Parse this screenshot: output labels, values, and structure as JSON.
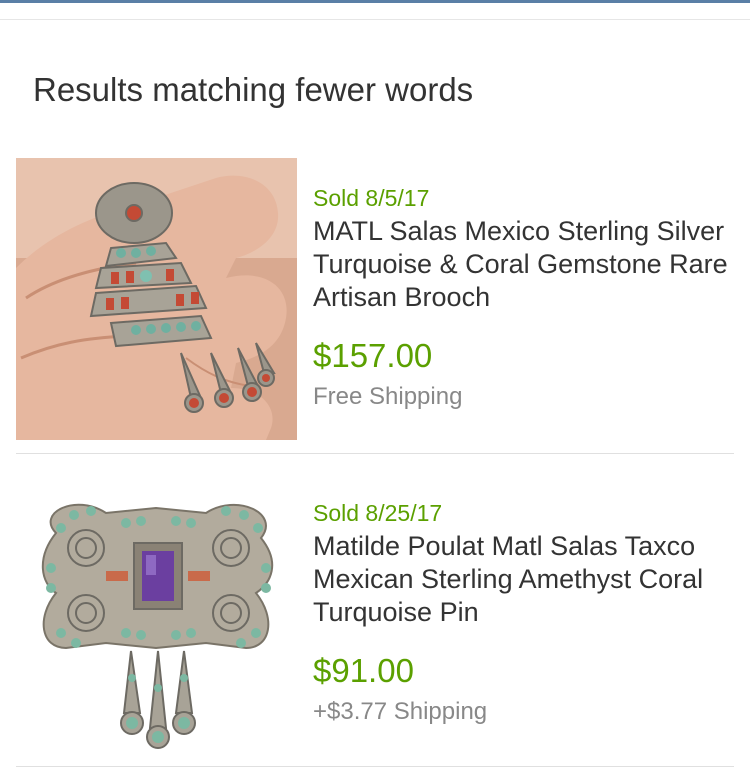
{
  "section": {
    "heading": "Results matching fewer words"
  },
  "listings": [
    {
      "sold": "Sold 8/5/17",
      "title": "MATL Salas Mexico Sterling Silver Turquoise & Coral Gemstone Rare Artisan Brooch",
      "price": "$157.00",
      "shipping": "Free Shipping"
    },
    {
      "sold": "Sold 8/25/17",
      "title": "Matilde Poulat Matl Salas Taxco Mexican Sterling Amethyst Coral Turquoise Pin",
      "price": "$91.00",
      "shipping": "+$3.77 Shipping"
    }
  ],
  "colors": {
    "accent_green": "#5ba000",
    "title_text": "#333333",
    "muted_text": "#888888",
    "divider": "#e0e0e0"
  }
}
